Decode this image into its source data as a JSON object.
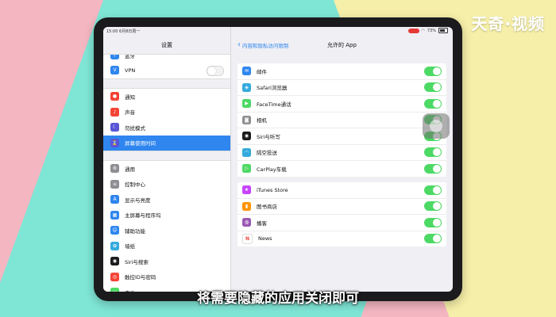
{
  "watermark": "天奇·视频",
  "status": {
    "time": "15:00",
    "date": "6月8日周一",
    "battery": "73%"
  },
  "sidebar": {
    "title": "设置",
    "group1": [
      {
        "label": "蓝牙",
        "icon": "bluetooth-icon",
        "color": "#2f86ef",
        "glyph": "ᛒ"
      },
      {
        "label": "VPN",
        "icon": "vpn-icon",
        "color": "#2f86ef",
        "glyph": "V"
      }
    ],
    "group2": [
      {
        "label": "通知",
        "icon": "notifications-icon",
        "color": "#f44336",
        "glyph": "●"
      },
      {
        "label": "声音",
        "icon": "sound-icon",
        "color": "#f44336",
        "glyph": "♪"
      },
      {
        "label": "勿扰模式",
        "icon": "moon-icon",
        "color": "#5856d6",
        "glyph": "☾"
      },
      {
        "label": "屏幕使用时间",
        "icon": "hourglass-icon",
        "color": "#5856d6",
        "glyph": "⌛"
      }
    ],
    "group3": [
      {
        "label": "通用",
        "icon": "gear-icon",
        "color": "#8e8e93",
        "glyph": "⚙"
      },
      {
        "label": "控制中心",
        "icon": "control-center-icon",
        "color": "#8e8e93",
        "glyph": "≡"
      },
      {
        "label": "显示与亮度",
        "icon": "display-icon",
        "color": "#2f86ef",
        "glyph": "A"
      },
      {
        "label": "主屏幕与程序坞",
        "icon": "home-screen-icon",
        "color": "#2f86ef",
        "glyph": "▦"
      },
      {
        "label": "辅助功能",
        "icon": "accessibility-icon",
        "color": "#2f86ef",
        "glyph": "☺"
      },
      {
        "label": "墙纸",
        "icon": "wallpaper-icon",
        "color": "#34aadc",
        "glyph": "✿"
      },
      {
        "label": "Siri与搜索",
        "icon": "siri-icon",
        "color": "#1c1c1e",
        "glyph": "◉"
      },
      {
        "label": "触控ID与密码",
        "icon": "touch-id-icon",
        "color": "#f44336",
        "glyph": "◎"
      },
      {
        "label": "电池",
        "icon": "battery-icon",
        "color": "#4cd964",
        "glyph": "▭"
      }
    ]
  },
  "main": {
    "back_label": "内容和隐私访问限制",
    "title": "允许的 App",
    "group1": [
      {
        "label": "邮件",
        "icon": "mail-icon",
        "color": "#2f86ef",
        "glyph": "✉"
      },
      {
        "label": "Safari浏览器",
        "icon": "safari-icon",
        "color": "#34aadc",
        "glyph": "◈"
      },
      {
        "label": "FaceTime通话",
        "icon": "facetime-icon",
        "color": "#4cd964",
        "glyph": "▶"
      },
      {
        "label": "相机",
        "icon": "camera-icon",
        "color": "#8e8e93",
        "glyph": "◙"
      },
      {
        "label": "Siri与听写",
        "icon": "siri-icon",
        "color": "#1c1c1e",
        "glyph": "◉"
      },
      {
        "label": "隔空投送",
        "icon": "airdrop-icon",
        "color": "#34aadc",
        "glyph": "◠"
      },
      {
        "label": "CarPlay车载",
        "icon": "carplay-icon",
        "color": "#4cd964",
        "glyph": "▷"
      }
    ],
    "group2": [
      {
        "label": "iTunes Store",
        "icon": "itunes-store-icon",
        "color": "#c644fc",
        "glyph": "★"
      },
      {
        "label": "图书商店",
        "icon": "books-icon",
        "color": "#ff9500",
        "glyph": "▮"
      },
      {
        "label": "播客",
        "icon": "podcasts-icon",
        "color": "#9b59b6",
        "glyph": "◍"
      },
      {
        "label": "News",
        "icon": "news-icon",
        "color": "#ffffff",
        "glyph": "N"
      }
    ]
  },
  "caption": "将需要隐藏的应用关闭即可"
}
